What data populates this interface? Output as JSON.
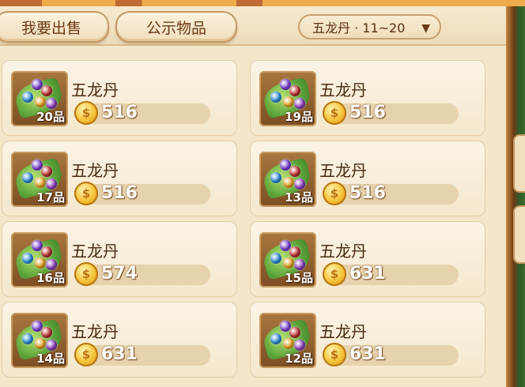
{
  "header": {
    "tabs": [
      {
        "label": "我要出售"
      },
      {
        "label": "公示物品"
      }
    ],
    "filter": {
      "label": "五龙丹 · 11~20"
    }
  },
  "items": [
    {
      "name": "五龙丹",
      "grade": "20品",
      "price": "516"
    },
    {
      "name": "五龙丹",
      "grade": "19品",
      "price": "516"
    },
    {
      "name": "五龙丹",
      "grade": "17品",
      "price": "516"
    },
    {
      "name": "五龙丹",
      "grade": "13品",
      "price": "516"
    },
    {
      "name": "五龙丹",
      "grade": "16品",
      "price": "574"
    },
    {
      "name": "五龙丹",
      "grade": "15品",
      "price": "631"
    },
    {
      "name": "五龙丹",
      "grade": "14品",
      "price": "631"
    },
    {
      "name": "五龙丹",
      "grade": "12品",
      "price": "631"
    }
  ],
  "icons": {
    "item": "five-dragon-pill-icon",
    "currency": "gold-coin-icon",
    "dropdown": "chevron-down-icon"
  }
}
